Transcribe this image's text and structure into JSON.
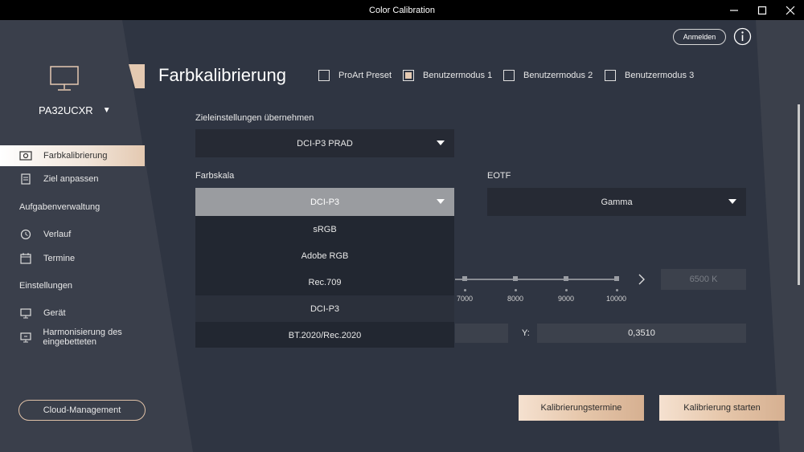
{
  "window": {
    "title": "Color Calibration",
    "minimize": "—",
    "maximize": "☐",
    "close": "✕"
  },
  "header": {
    "login": "Anmelden",
    "page_title": "Farbkalibrierung"
  },
  "modes": [
    {
      "label": "ProArt Preset",
      "checked": false
    },
    {
      "label": "Benutzermodus 1",
      "checked": true
    },
    {
      "label": "Benutzermodus 2",
      "checked": false
    },
    {
      "label": "Benutzermodus 3",
      "checked": false
    }
  ],
  "sidebar": {
    "model": "PA32UCXR",
    "items": [
      {
        "label": "Farbkalibrierung",
        "icon": "camera-icon",
        "active": true
      },
      {
        "label": "Ziel anpassen",
        "icon": "document-icon",
        "active": false
      }
    ],
    "section_tasks": "Aufgabenverwaltung",
    "task_items": [
      {
        "label": "Verlauf",
        "icon": "history-icon"
      },
      {
        "label": "Termine",
        "icon": "calendar-icon"
      }
    ],
    "section_settings": "Einstellungen",
    "settings_items": [
      {
        "label": "Gerät",
        "icon": "monitor-icon"
      },
      {
        "label": "Harmonisierung des eingebetteten",
        "icon": "monitor-sync-icon"
      }
    ],
    "cloud_button": "Cloud-Management"
  },
  "form": {
    "target_label": "Zieleinstellungen übernehmen",
    "target_value": "DCI-P3 PRAD",
    "gamut_label": "Farbskala",
    "gamut_value": "DCI-P3",
    "eotf_label": "EOTF",
    "eotf_value": "Gamma",
    "gamut_options": [
      "sRGB",
      "Adobe RGB",
      "Rec.709",
      "DCI-P3",
      "BT.2020/Rec.2020"
    ],
    "gamut_selected_index": 3,
    "temperature_ticks": [
      "7000",
      "8000",
      "9000",
      "10000"
    ],
    "kelvin_value": "6500 K",
    "y_label": "Y:",
    "y_value": "0,3510"
  },
  "actions": {
    "schedule": "Kalibrierungstermine",
    "start": "Kalibrierung starten"
  },
  "colors": {
    "accent": "#e4c9b1",
    "background": "#2f3542",
    "sidebar": "#3a3f4b"
  }
}
